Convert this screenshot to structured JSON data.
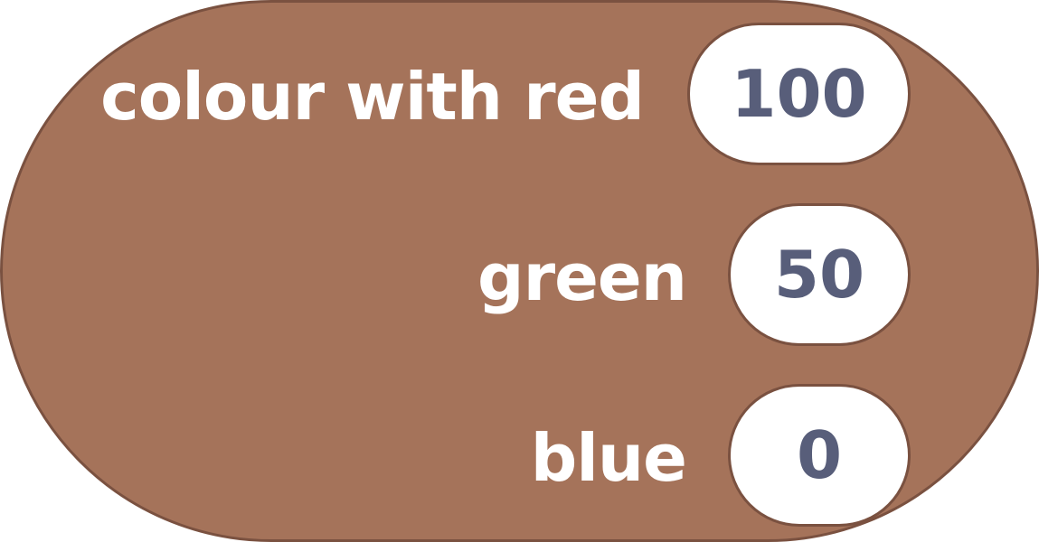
{
  "block": {
    "label_red": "colour with red",
    "label_green": "green",
    "label_blue": "blue",
    "red_value": "100",
    "green_value": "50",
    "blue_value": "0"
  },
  "colors": {
    "block_fill": "#a5735a",
    "block_border": "#7a5140",
    "label_text": "#ffffff",
    "input_text": "#585e7a",
    "input_fill": "#ffffff"
  }
}
